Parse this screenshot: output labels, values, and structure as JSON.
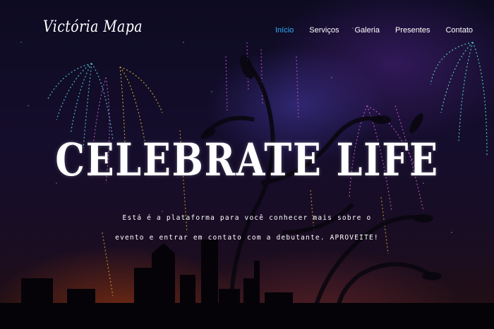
{
  "brand": {
    "name": "Victória Mapa"
  },
  "nav": {
    "items": [
      {
        "label": "Início",
        "active": true
      },
      {
        "label": "Serviços",
        "active": false
      },
      {
        "label": "Galeria",
        "active": false
      },
      {
        "label": "Presentes",
        "active": false
      },
      {
        "label": "Contato",
        "active": false
      }
    ]
  },
  "hero": {
    "headline": "CELEBRATE LIFE",
    "subtitle": "Está é a plataforma para você conhecer mais sobre o evento e entrar em contato com a debutante. APROVEITE!"
  },
  "colors": {
    "nav_active": "#33b0ff",
    "text": "#ffffff"
  }
}
